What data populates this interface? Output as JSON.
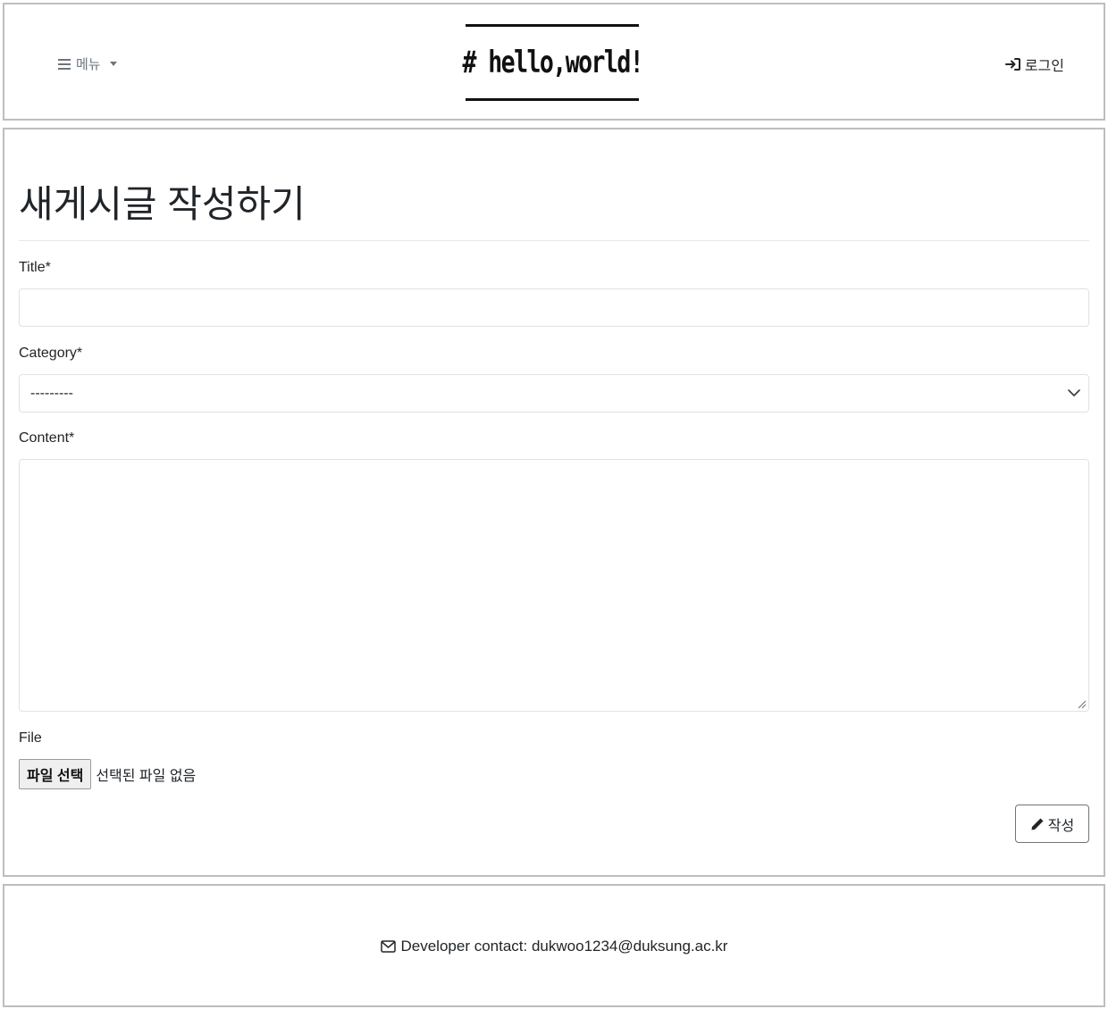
{
  "header": {
    "menu_label": "메뉴",
    "menu_icon": "bars-icon",
    "logo_text": "# hello,world!",
    "login_label": "로그인",
    "login_icon": "sign-in-icon"
  },
  "form": {
    "page_title": "새게시글 작성하기",
    "title_label": "Title*",
    "title_value": "",
    "category_label": "Category*",
    "category_selected": "---------",
    "content_label": "Content*",
    "content_value": "",
    "file_label": "File",
    "file_button_label": "파일 선택",
    "file_status": "선택된 파일 없음",
    "submit_label": "작성",
    "submit_icon": "pencil-icon"
  },
  "footer": {
    "contact_text": "Developer contact: dukwoo1234@duksung.ac.kr",
    "contact_icon": "envelope-icon"
  }
}
